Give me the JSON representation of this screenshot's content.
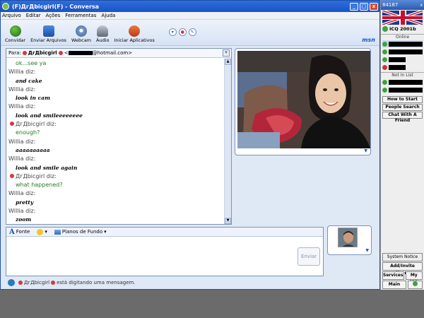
{
  "window": {
    "title": "(F)ДгДbicgirl(F) - Conversa",
    "buttons": [
      "_",
      "□",
      "x"
    ]
  },
  "menu": [
    "Arquivo",
    "Editar",
    "Ações",
    "Ferramentas",
    "Ajuda"
  ],
  "toolbar": {
    "buttons": [
      {
        "label": "Convidar",
        "icon": "invite-icon"
      },
      {
        "label": "Enviar Arquivos",
        "icon": "send-files-icon"
      },
      {
        "label": "Webcam",
        "icon": "webcam-icon"
      },
      {
        "label": "Áudio",
        "icon": "microphone-icon"
      },
      {
        "label": "Iniciar Aplicativos",
        "icon": "apps-icon"
      }
    ],
    "logo": "msn"
  },
  "to_line": {
    "label": "Para:",
    "contact": "ДгДbicgirl",
    "email_suffix": "@hotmail.com>",
    "email_prefix": "<"
  },
  "messages": [
    {
      "sender": "",
      "text": "ok...see ya",
      "who": "her"
    },
    {
      "sender": "Willia diz:",
      "text": "and cake",
      "who": "willia"
    },
    {
      "sender": "Willia diz:",
      "text": "look in cam",
      "who": "willia"
    },
    {
      "sender": "Willia diz:",
      "text": "look and smileeeeeeee",
      "who": "willia"
    },
    {
      "sender": "ДгДbicgirl diz:",
      "text": "enough?",
      "who": "her"
    },
    {
      "sender": "Willia diz:",
      "text": "aaaaaaaaaa",
      "who": "willia"
    },
    {
      "sender": "Willia diz:",
      "text": "look and smile again",
      "who": "willia"
    },
    {
      "sender": "ДгДbicgirl diz:",
      "text": "what happened?",
      "who": "her"
    },
    {
      "sender": "Willia diz:",
      "text": "pretty",
      "who": "willia"
    },
    {
      "sender": "Willia diz:",
      "text": "zoom",
      "who": "willia"
    }
  ],
  "compose": {
    "font_label": "Fonte",
    "backgrounds_label": "Planos de Fundo",
    "send_label": "Enviar"
  },
  "status": {
    "contact": "ДгДbicgirl",
    "text": "está digitando uma mensagem."
  },
  "icq": {
    "top_number": "84187",
    "close": "x",
    "brand": "ICQ 2001b",
    "online_label": "Online",
    "not_in_list_label": "Not In List",
    "buttons": [
      "How to Start",
      "People Search",
      "Chat With A Friend"
    ],
    "bottom": {
      "system_notice": "System Notice",
      "add_invite": "Add/Invite Users",
      "services": "Services",
      "my_icq": "My ICQ",
      "main": "Main"
    }
  },
  "colors": {
    "title_bar": "#1a53c4",
    "her_text": "#2a7a2a"
  }
}
